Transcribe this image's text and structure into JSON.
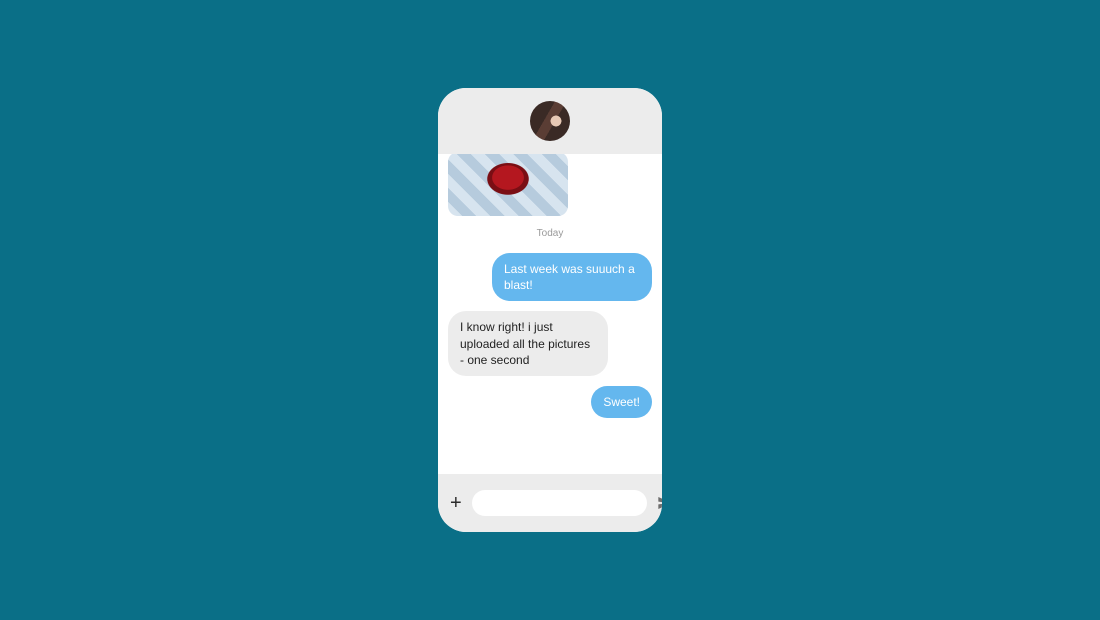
{
  "header": {
    "avatar_name": "contact-avatar"
  },
  "thread": {
    "media_alt": "shared-photo",
    "date_separator": "Today",
    "messages": [
      {
        "side": "sent",
        "text": "Last week was suuuch a blast!"
      },
      {
        "side": "received",
        "text": "I know right! i just uploaded all the pictures - one second"
      },
      {
        "side": "sent",
        "text": "Sweet!"
      }
    ]
  },
  "composer": {
    "placeholder": "",
    "value": ""
  },
  "colors": {
    "page_bg": "#0a6f87",
    "sent_bubble": "#64b7ee",
    "received_bubble": "#ececec"
  }
}
